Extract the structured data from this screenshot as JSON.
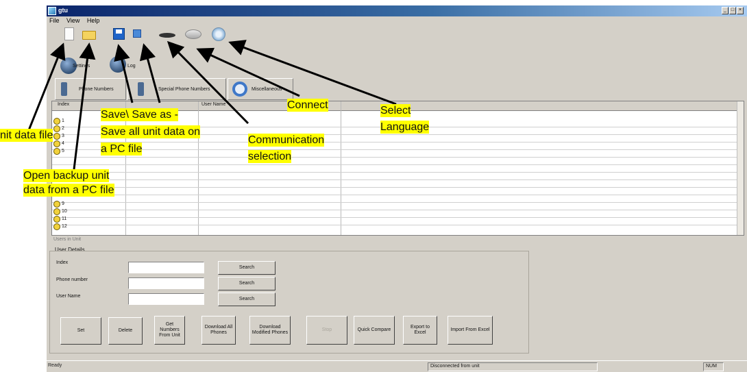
{
  "window": {
    "title": "gtu"
  },
  "menu": [
    "File",
    "View",
    "Help"
  ],
  "subtoolbar": {
    "settings": "Settings",
    "log": "Log"
  },
  "tabs": [
    "Phone Numbers",
    "Special Phone Numbers",
    "Miscellaneous"
  ],
  "grid": {
    "columns": [
      "Index",
      "User Name"
    ],
    "rows": [
      "1",
      "2",
      "3",
      "4",
      "5",
      "9",
      "10",
      "11",
      "12"
    ],
    "footer": "Users in Unit"
  },
  "details": {
    "group": "User Details",
    "index_label": "Index",
    "phone_label": "Phone number",
    "name_label": "User Name",
    "search": "Search"
  },
  "buttons": {
    "set": "Set",
    "delete": "Delete",
    "get_numbers": "Get Numbers From Unit",
    "download_all": "Download All Phones",
    "download_modified": "Download Modified Phones",
    "stop": "Stop",
    "quick_compare": "Quick Compare",
    "export": "Export to Excel",
    "import": "Import From Excel"
  },
  "status": {
    "left": "Ready",
    "mid": "Disconnected from unit",
    "right": "NUM"
  },
  "annotations": {
    "new_file": "nit data file",
    "open_1": "Open backup unit",
    "open_2": "data from a PC file",
    "save_1": "Save\\ Save as -",
    "save_2": "Save all unit data on",
    "save_3": "a PC file",
    "comm_1": "Communication",
    "comm_2": "selection",
    "connect": "Connect",
    "lang_1": "Select",
    "lang_2": "Language"
  },
  "colors": {
    "highlight": "#ffff00",
    "title_bar": "#0a246a",
    "face": "#d4d0c8"
  }
}
